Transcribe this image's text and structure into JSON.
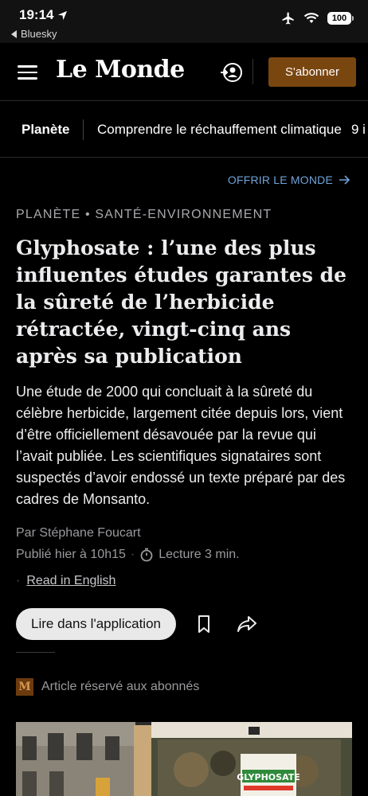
{
  "status_bar": {
    "time": "19:14",
    "back_label": "Bluesky",
    "battery": "100"
  },
  "header": {
    "logo": "Le Monde",
    "subscribe_label": "S'abonner"
  },
  "subnav": {
    "section": "Planète",
    "items": [
      "Comprendre le réchauffement climatique",
      "9 i"
    ]
  },
  "article": {
    "offer_label": "OFFRIR LE MONDE",
    "kicker": "PLANÈTE • SANTÉ-ENVIRONNEMENT",
    "title": "Glyphosate : l’une des plus influentes études garantes de la sûreté de l’herbicide rétractée, vingt-cinq ans après sa publication",
    "lead": "Une étude de 2000 qui concluait à la sûreté du célèbre herbicide, largement citée depuis lors, vient d’être officiellement désavouée par la revue qui l’avait publiée. Les scientifiques signataires sont suspectés d’avoir endossé un texte préparé par des cadres de Monsanto.",
    "byline": "Par Stéphane Foucart",
    "published": "Publié hier à 10h15",
    "reading_time": "Lecture 3 min.",
    "read_in_english": "Read in English",
    "app_button": "Lire dans l'application",
    "reserved_badge": "M",
    "reserved_label": "Article réservé aux abonnés",
    "image_sign_text": "GLYPHOSATE"
  },
  "colors": {
    "background": "#000000",
    "subscribe_bg": "#7a4610",
    "link_blue": "#6fa2d8",
    "muted_text": "#9a9a9e"
  }
}
